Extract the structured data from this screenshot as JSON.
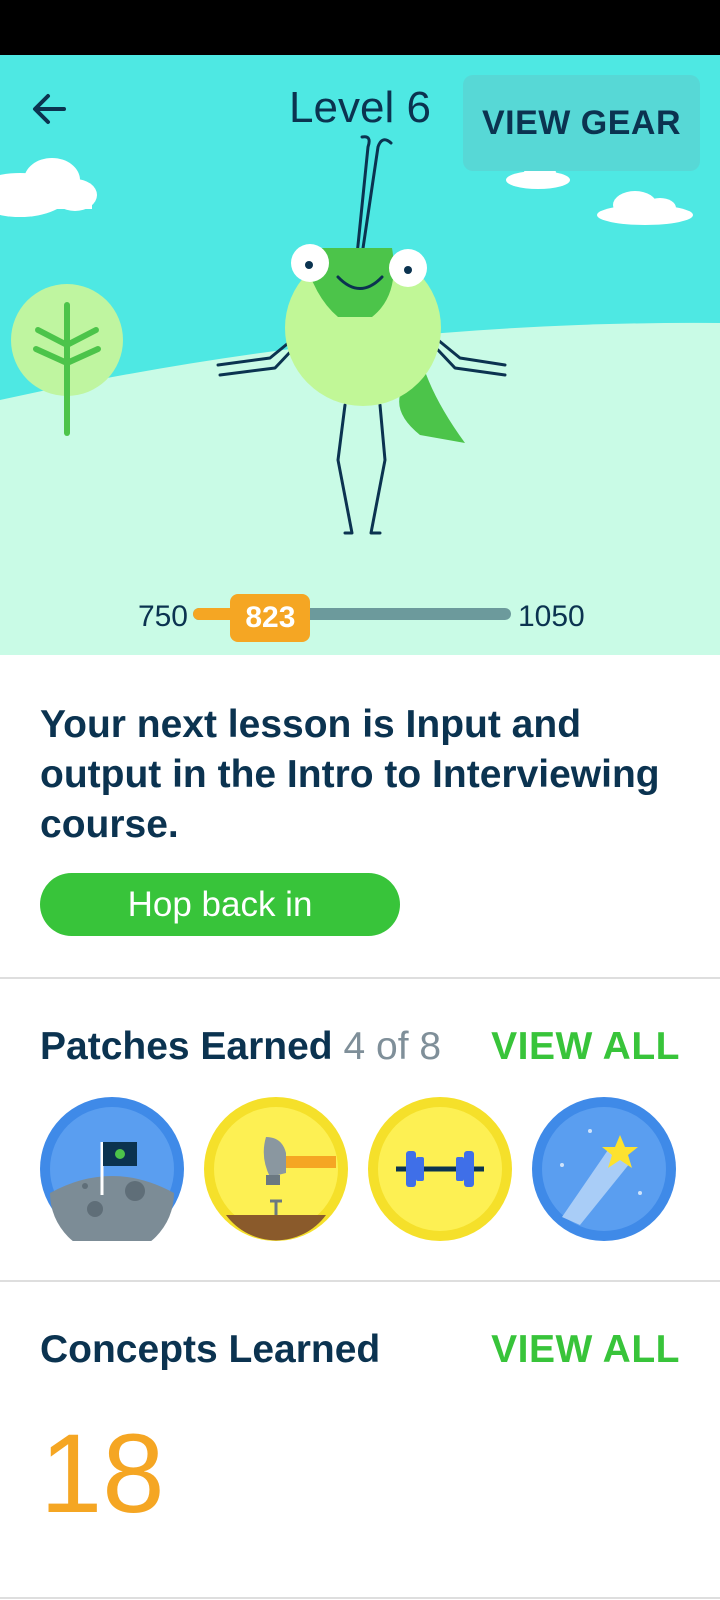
{
  "header": {
    "back_icon": "arrow-left-icon",
    "level_title": "Level 6",
    "view_gear_label": "VIEW GEAR"
  },
  "progress": {
    "min": "750",
    "max": "1050",
    "current": "823",
    "min_value": 750,
    "max_value": 1050,
    "current_value": 823
  },
  "next_lesson": {
    "text": "Your next lesson is Input and output in the Intro to Interviewing course.",
    "button_label": "Hop back in"
  },
  "patches": {
    "title": "Patches Earned",
    "count": "4 of 8",
    "view_all_label": "VIEW ALL",
    "items": [
      {
        "icon": "moon-flag-patch-icon"
      },
      {
        "icon": "hammer-nail-patch-icon"
      },
      {
        "icon": "dumbbell-patch-icon"
      },
      {
        "icon": "shooting-star-patch-icon"
      }
    ]
  },
  "concepts": {
    "title": "Concepts Learned",
    "view_all_label": "VIEW ALL",
    "count": "18"
  },
  "colors": {
    "sky": "#4ee8e3",
    "hill": "#c9fbe6",
    "accent_green": "#38c43a",
    "accent_orange": "#f5a623",
    "text_dark": "#0b3350",
    "progress_track": "#6c9a9c"
  }
}
